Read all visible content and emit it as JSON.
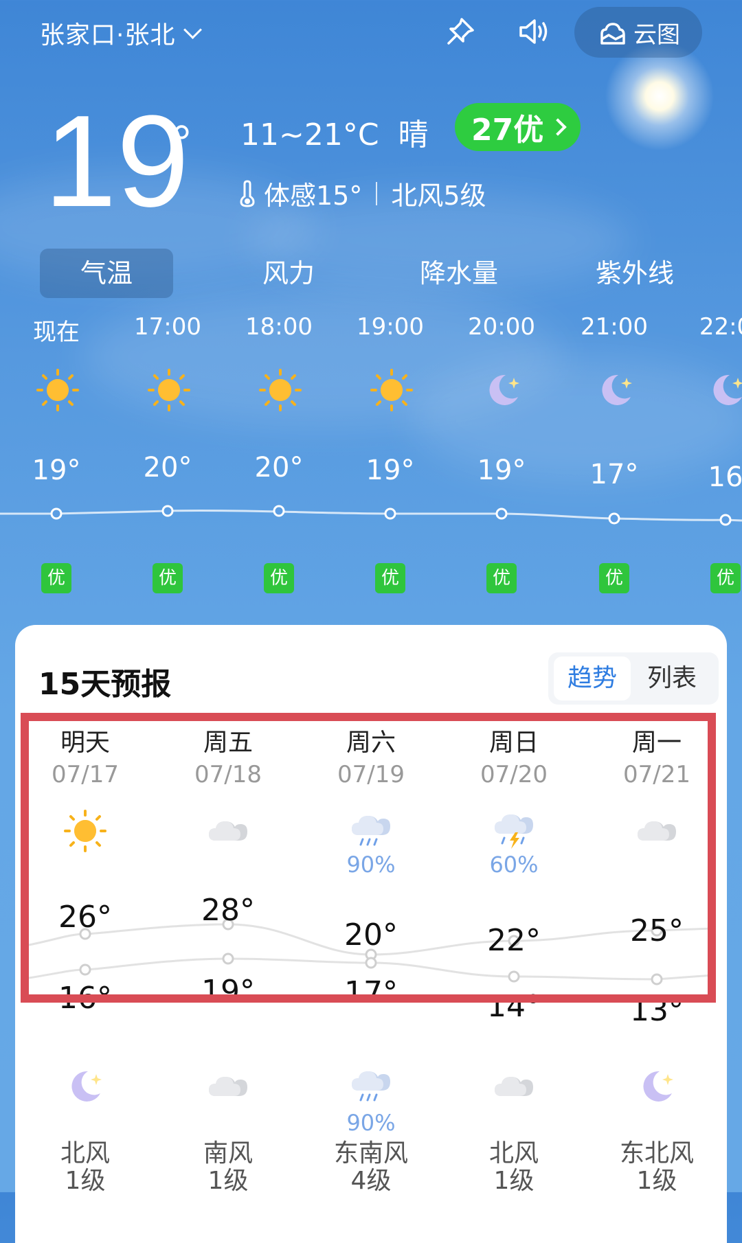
{
  "header": {
    "location": "张家口·张北",
    "cloud_map_label": "云图"
  },
  "current": {
    "temp": "19",
    "deg": "°",
    "range_text": "11~21°C  晴",
    "aqi_label": "27优",
    "feels_like": "体感15°",
    "wind": "北风5级"
  },
  "tabs": [
    {
      "label": "气温",
      "active": true
    },
    {
      "label": "风力",
      "active": false
    },
    {
      "label": "降水量",
      "active": false
    },
    {
      "label": "紫外线",
      "active": false
    }
  ],
  "hourly": [
    {
      "time": "现在",
      "icon": "sun-icon",
      "temp": "19°",
      "aqi": "优"
    },
    {
      "time": "17:00",
      "icon": "sun-icon",
      "temp": "20°",
      "aqi": "优"
    },
    {
      "time": "18:00",
      "icon": "sun-icon",
      "temp": "20°",
      "aqi": "优"
    },
    {
      "time": "19:00",
      "icon": "sun-icon",
      "temp": "19°",
      "aqi": "优"
    },
    {
      "time": "20:00",
      "icon": "moon-icon",
      "temp": "19°",
      "aqi": "优"
    },
    {
      "time": "21:00",
      "icon": "moon-icon",
      "temp": "17°",
      "aqi": "优"
    },
    {
      "time": "22:0",
      "icon": "moon-icon",
      "temp": "16",
      "aqi": "优"
    }
  ],
  "forecast": {
    "title": "15天预报",
    "toggle_trend": "趋势",
    "toggle_list": "列表",
    "days": [
      {
        "name": "明天",
        "date": "07/17",
        "day_icon": "sun-icon",
        "day_precip": "",
        "hi": "26°",
        "lo": "16°",
        "night_icon": "moon-icon",
        "night_precip": "",
        "wind_dir": "北风",
        "wind_level": "1级"
      },
      {
        "name": "周五",
        "date": "07/18",
        "day_icon": "cloud-icon",
        "day_precip": "",
        "hi": "28°",
        "lo": "19°",
        "night_icon": "cloud-icon",
        "night_precip": "",
        "wind_dir": "南风",
        "wind_level": "1级"
      },
      {
        "name": "周六",
        "date": "07/19",
        "day_icon": "rain-icon",
        "day_precip": "90%",
        "hi": "20°",
        "lo": "17°",
        "night_icon": "rain-icon",
        "night_precip": "90%",
        "wind_dir": "东南风",
        "wind_level": "4级"
      },
      {
        "name": "周日",
        "date": "07/20",
        "day_icon": "thunderstorm-icon",
        "day_precip": "60%",
        "hi": "22°",
        "lo": "14°",
        "night_icon": "cloud-icon",
        "night_precip": "",
        "wind_dir": "北风",
        "wind_level": "1级"
      },
      {
        "name": "周一",
        "date": "07/21",
        "day_icon": "cloud-icon",
        "day_precip": "",
        "hi": "25°",
        "lo": "13°",
        "night_icon": "moon-icon",
        "night_precip": "",
        "wind_dir": "东北风",
        "wind_level": "1级"
      }
    ]
  },
  "colors": {
    "aqi_good": "#2ecc40",
    "highlight_border": "#d94c55",
    "toggle_active": "#2f7de1"
  }
}
